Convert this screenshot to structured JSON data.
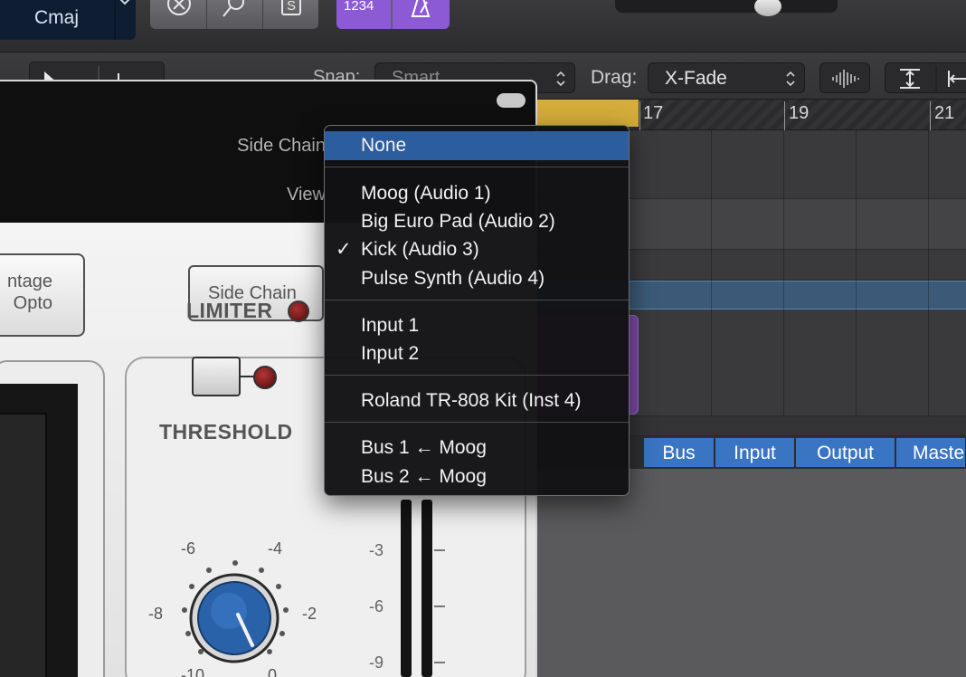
{
  "toolbar": {
    "key_signature": "Cmaj",
    "count_in": "1234",
    "tool_solo_glyph": "S"
  },
  "toolbar2": {
    "snap_label": "Snap:",
    "snap_value": "Smart",
    "drag_label": "Drag:",
    "drag_value": "X-Fade"
  },
  "ruler": {
    "bar_numbers": [
      "17",
      "19",
      "21"
    ]
  },
  "mixer_tabs": [
    "Bus",
    "Input",
    "Output",
    "Master"
  ],
  "plugin": {
    "side_chain_label": "Side Chain",
    "view_label": "View",
    "model_button_line1": "ntage",
    "model_button_line2": "Opto",
    "side_chain_button": "Side Chain",
    "limiter_label": "LIMITER",
    "threshold_label": "THRESHOLD",
    "threshold_scale": [
      "-6",
      "-4",
      "-8",
      "-2",
      "-10",
      "0"
    ],
    "fader_scale": [
      "-3",
      "-6",
      "-9"
    ]
  },
  "side_chain_menu": {
    "items": [
      {
        "label": "None",
        "highlighted": true,
        "checked": false
      },
      {
        "label": "Moog (Audio 1)",
        "highlighted": false,
        "checked": false
      },
      {
        "label": "Big Euro Pad (Audio 2)",
        "highlighted": false,
        "checked": false
      },
      {
        "label": "Kick (Audio 3)",
        "highlighted": false,
        "checked": true
      },
      {
        "label": "Pulse Synth (Audio 4)",
        "highlighted": false,
        "checked": false
      },
      {
        "label": "Input 1",
        "highlighted": false,
        "checked": false
      },
      {
        "label": "Input 2",
        "highlighted": false,
        "checked": false
      },
      {
        "label": "Roland TR-808 Kit (Inst 4)",
        "highlighted": false,
        "checked": false
      },
      {
        "label": "Bus 1 ← Moog",
        "highlighted": false,
        "checked": false
      },
      {
        "label": "Bus 2 ← Moog",
        "highlighted": false,
        "checked": false
      }
    ],
    "check_glyph": "✓"
  },
  "colors": {
    "menu_highlight": "#2c5d9e",
    "cycle_region": "#d4ad3a",
    "midi_region": "#7d4aa8",
    "mixer_tab": "#3a75c4",
    "purple_button": "#8d5ad6",
    "limiter_led": "#a83232"
  },
  "icons": [
    "chevron-down-icon",
    "close-circle-icon",
    "tuner-icon",
    "solo-icon",
    "metronome-icon",
    "pointer-tool-icon",
    "pencil-tool-icon",
    "updown-chevron-icon",
    "waveform-zoom-icon",
    "vertical-zoom-icon",
    "horizontal-zoom-icon"
  ]
}
